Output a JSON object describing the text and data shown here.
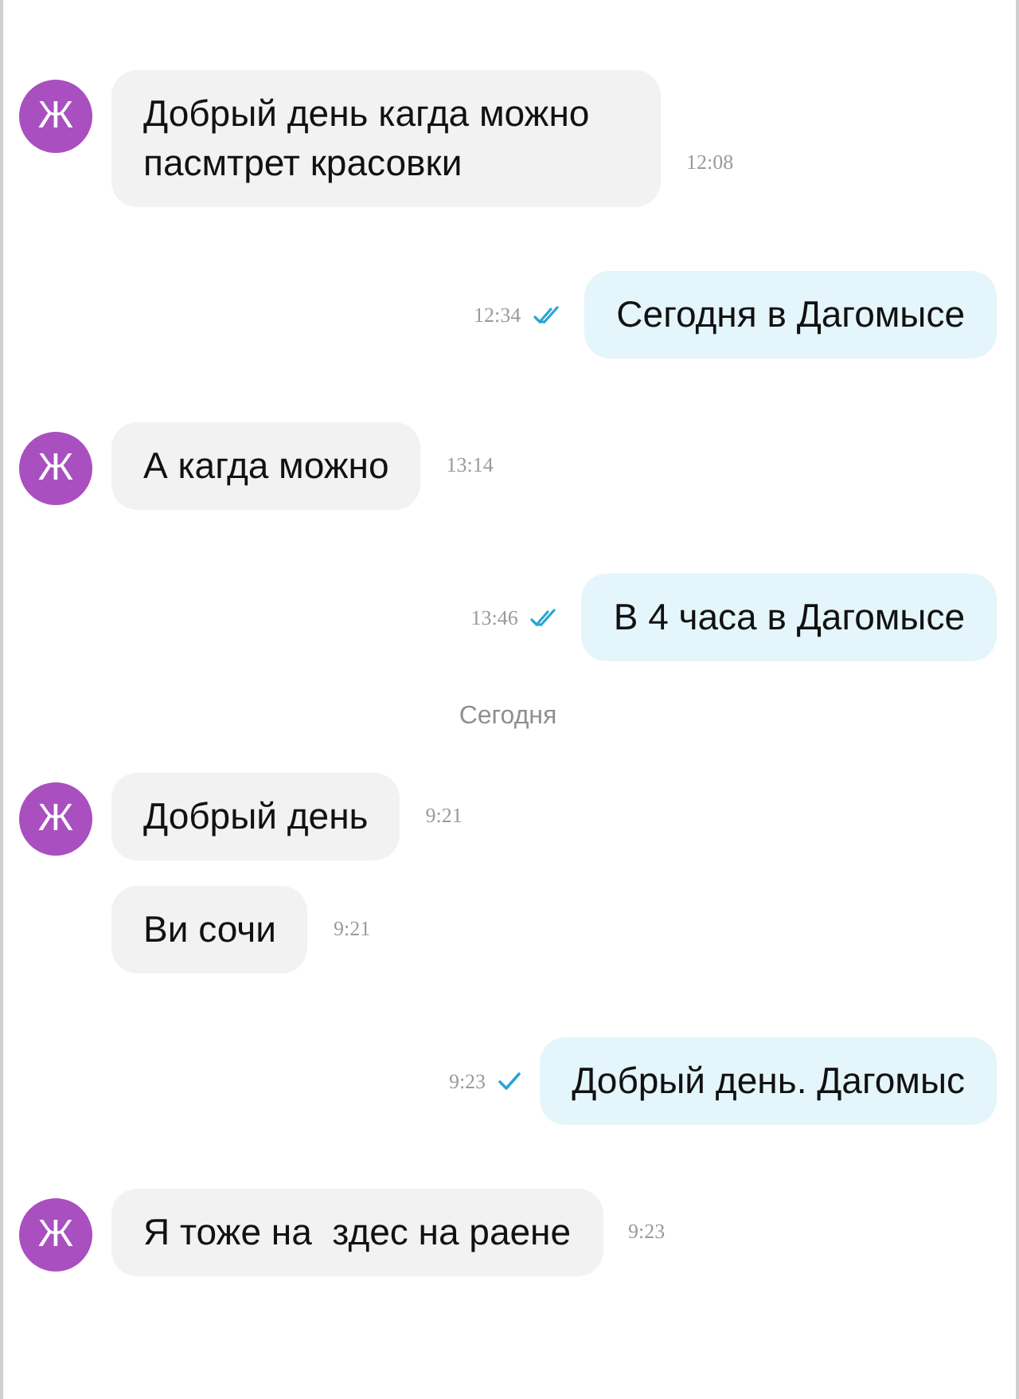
{
  "messages": [
    {
      "kind": "incoming",
      "avatar": "Ж",
      "text": "Добрый день кагда можно пасмтрет красовки",
      "time": "12:08"
    },
    {
      "kind": "outgoing",
      "text": "Сегодня в Дагомысе",
      "time": "12:34",
      "read": true
    },
    {
      "kind": "incoming",
      "avatar": "Ж",
      "text": "А кагда можно",
      "time": "13:14"
    },
    {
      "kind": "outgoing",
      "text": "В 4 часа в Дагомысе",
      "time": "13:46",
      "read": true
    },
    {
      "kind": "date",
      "text": "Сегодня"
    },
    {
      "kind": "incoming",
      "avatar": "Ж",
      "text": "Добрый день",
      "time": "9:21"
    },
    {
      "kind": "incoming",
      "text": "Ви сочи",
      "time": "9:21"
    },
    {
      "kind": "outgoing",
      "text": "Добрый день. Дагомыс",
      "time": "9:23",
      "read": false
    },
    {
      "kind": "incoming",
      "avatar": "Ж",
      "text": "Я тоже на  здес на раене",
      "time": "9:23"
    }
  ]
}
